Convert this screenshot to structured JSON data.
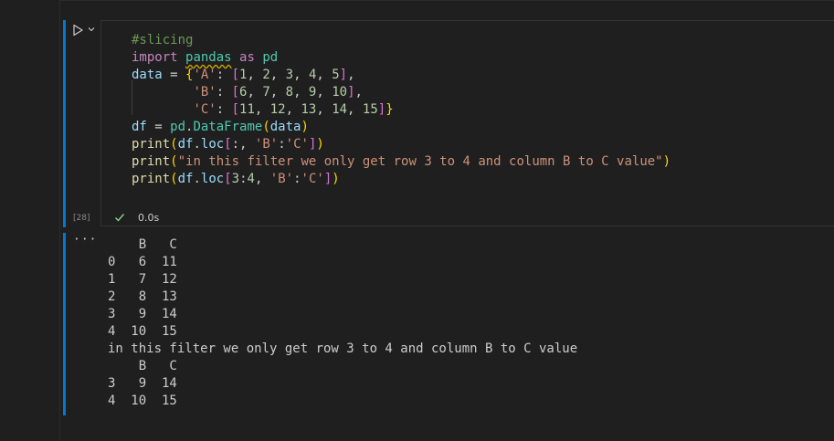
{
  "cell": {
    "execution_count": "[28]",
    "status_time": "0.0s",
    "code_lines": [
      [
        {
          "t": "#slicing",
          "c": "c"
        }
      ],
      [
        {
          "t": "import",
          "c": "k"
        },
        {
          "t": " "
        },
        {
          "t": "pandas",
          "c": "m squig"
        },
        {
          "t": " "
        },
        {
          "t": "as",
          "c": "k"
        },
        {
          "t": " "
        },
        {
          "t": "pd",
          "c": "m"
        }
      ],
      [
        {
          "t": "data",
          "c": "v"
        },
        {
          "t": " = "
        },
        {
          "t": "{",
          "c": "b1"
        },
        {
          "t": "'A'",
          "c": "s"
        },
        {
          "t": ": "
        },
        {
          "t": "[",
          "c": "b2"
        },
        {
          "t": "1",
          "c": "n"
        },
        {
          "t": ", "
        },
        {
          "t": "2",
          "c": "n"
        },
        {
          "t": ", "
        },
        {
          "t": "3",
          "c": "n"
        },
        {
          "t": ", "
        },
        {
          "t": "4",
          "c": "n"
        },
        {
          "t": ", "
        },
        {
          "t": "5",
          "c": "n"
        },
        {
          "t": "]",
          "c": "b2"
        },
        {
          "t": ","
        }
      ],
      [
        {
          "t": "        "
        },
        {
          "t": "'B'",
          "c": "s"
        },
        {
          "t": ": "
        },
        {
          "t": "[",
          "c": "b2"
        },
        {
          "t": "6",
          "c": "n"
        },
        {
          "t": ", "
        },
        {
          "t": "7",
          "c": "n"
        },
        {
          "t": ", "
        },
        {
          "t": "8",
          "c": "n"
        },
        {
          "t": ", "
        },
        {
          "t": "9",
          "c": "n"
        },
        {
          "t": ", "
        },
        {
          "t": "10",
          "c": "n"
        },
        {
          "t": "]",
          "c": "b2"
        },
        {
          "t": ","
        }
      ],
      [
        {
          "t": "        "
        },
        {
          "t": "'C'",
          "c": "s"
        },
        {
          "t": ": "
        },
        {
          "t": "[",
          "c": "b2"
        },
        {
          "t": "11",
          "c": "n"
        },
        {
          "t": ", "
        },
        {
          "t": "12",
          "c": "n"
        },
        {
          "t": ", "
        },
        {
          "t": "13",
          "c": "n"
        },
        {
          "t": ", "
        },
        {
          "t": "14",
          "c": "n"
        },
        {
          "t": ", "
        },
        {
          "t": "15",
          "c": "n"
        },
        {
          "t": "]",
          "c": "b2"
        },
        {
          "t": "}",
          "c": "b1"
        }
      ],
      [
        {
          "t": "df",
          "c": "v"
        },
        {
          "t": " = "
        },
        {
          "t": "pd",
          "c": "m"
        },
        {
          "t": "."
        },
        {
          "t": "DataFrame",
          "c": "m"
        },
        {
          "t": "(",
          "c": "b1"
        },
        {
          "t": "data",
          "c": "v"
        },
        {
          "t": ")",
          "c": "b1"
        }
      ],
      [
        {
          "t": "print",
          "c": "f"
        },
        {
          "t": "(",
          "c": "b1"
        },
        {
          "t": "df",
          "c": "v"
        },
        {
          "t": "."
        },
        {
          "t": "loc",
          "c": "v"
        },
        {
          "t": "[",
          "c": "b2"
        },
        {
          "t": ":, "
        },
        {
          "t": "'B'",
          "c": "s"
        },
        {
          "t": ":"
        },
        {
          "t": "'C'",
          "c": "s"
        },
        {
          "t": "]",
          "c": "b2"
        },
        {
          "t": ")",
          "c": "b1"
        }
      ],
      [
        {
          "t": "print",
          "c": "f"
        },
        {
          "t": "(",
          "c": "b1"
        },
        {
          "t": "\"in this filter we only get row 3 to 4 and column B to C value\"",
          "c": "s"
        },
        {
          "t": ")",
          "c": "b1"
        }
      ],
      [
        {
          "t": "print",
          "c": "f"
        },
        {
          "t": "(",
          "c": "b1"
        },
        {
          "t": "df",
          "c": "v"
        },
        {
          "t": "."
        },
        {
          "t": "loc",
          "c": "v"
        },
        {
          "t": "[",
          "c": "b2"
        },
        {
          "t": "3",
          "c": "n"
        },
        {
          "t": ":"
        },
        {
          "t": "4",
          "c": "n"
        },
        {
          "t": ", "
        },
        {
          "t": "'B'",
          "c": "s"
        },
        {
          "t": ":"
        },
        {
          "t": "'C'",
          "c": "s"
        },
        {
          "t": "]",
          "c": "b2"
        },
        {
          "t": ")",
          "c": "b1"
        }
      ]
    ]
  },
  "output": {
    "more_label": "···",
    "lines": [
      "    B   C",
      "0   6  11",
      "1   7  12",
      "2   8  13",
      "3   9  14",
      "4  10  15",
      "in this filter we only get row 3 to 4 and column B to C value",
      "    B   C",
      "3   9  14",
      "4  10  15"
    ]
  },
  "colors": {
    "accent_bar": "#0078d4",
    "success_check": "#89d185",
    "background": "#1f1f1f"
  },
  "icons": {
    "run": "run-play-icon",
    "chevron": "chevron-down-icon",
    "check": "check-icon"
  }
}
